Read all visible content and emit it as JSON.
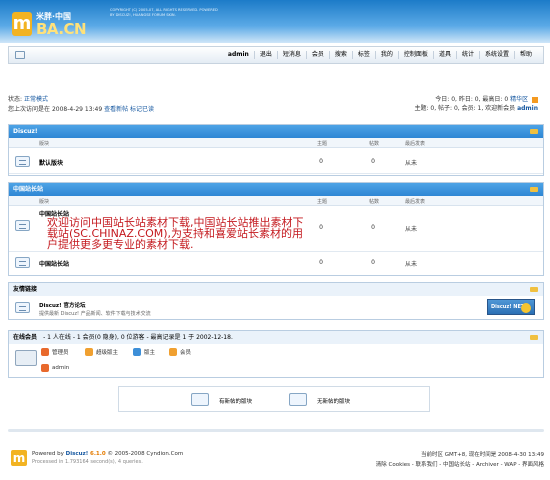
{
  "header": {
    "logo_letter": "m",
    "logo_line1": "米胖·中国",
    "logo_line2": "BA.CN",
    "copyright": "COPYRIGHT (C) 2005-07, ALL RIGHTS RESERVED. POWERED BY DISCUZ!, HUANGSE FORUM SKIN."
  },
  "nav": {
    "items": [
      "admin",
      "退出",
      "短消息",
      "会员",
      "搜索",
      "标签",
      "我的",
      "控制面板",
      "道具",
      "统计",
      "系统设置",
      "帮助"
    ]
  },
  "status": {
    "mode_label": "状态:",
    "mode_value": "正常模式",
    "last_visit_label": "您上次访问是在",
    "last_visit_time": "2008-4-29 13:49",
    "view_new": "查看新帖",
    "mark_read": "标记已读",
    "today_stats": "今日: 0, 昨日: 0, 最高日: 0",
    "digest": "精华区",
    "totals": "主题: 0, 帖子: 0, 会员: 1, 欢迎新会员",
    "new_member": "admin"
  },
  "col_headers": {
    "forum": "版块",
    "topics": "主题",
    "posts": "帖数",
    "last": "最后发表"
  },
  "categories": [
    {
      "title": "Discuz!",
      "forums": [
        {
          "name": "默认版块",
          "topics": "0",
          "posts": "0",
          "last": "从未"
        }
      ]
    },
    {
      "title": "中国站长站",
      "forums": [
        {
          "name": "中国站长站",
          "topics": "0",
          "posts": "0",
          "last": "从未",
          "promo": "欢迎访问中国站长站素材下载,中国站长站推出素材下载站(SC.CHINAZ.COM),为支持和喜爱站长素材的用户提供更多更专业的素材下载."
        },
        {
          "name": "中国站长站",
          "topics": "0",
          "posts": "0",
          "last": "从未"
        }
      ]
    }
  ],
  "links": {
    "title": "友情链接",
    "name": "Discuz! 官方论坛",
    "desc": "提供最新 Discuz! 产品新闻、软件下载与技术交流",
    "badge": "Discuz! NET"
  },
  "online": {
    "title": "在线会员",
    "summary": "- 1 人在线 - 1 会员(0 隐身), 0 位游客 - 最高记录是 1 于 2002-12-18.",
    "legend": [
      "管理员",
      "超级版主",
      "版主",
      "会员"
    ],
    "user": "admin",
    "colors": [
      "#e8692c",
      "#f0a030",
      "#3d8fd8",
      "#f0a030"
    ]
  },
  "new_posts": {
    "has_new": "有新帖的版块",
    "no_new": "无新帖的版块"
  },
  "footer": {
    "logo_letter": "m",
    "powered": "Powered by",
    "product": "Discuz!",
    "version": "6.1.0",
    "copyright": "© 2005-2008 Cyndion.Com",
    "processed": "Processed in 1.793164 second(s), 4 queries.",
    "timezone": "当前时区 GMT+8, 现在时间是 2008-4-30 13:49",
    "links": "清除 Cookies - 联系我们 - 中国站长站 - Archiver - WAP - 界面风格"
  }
}
